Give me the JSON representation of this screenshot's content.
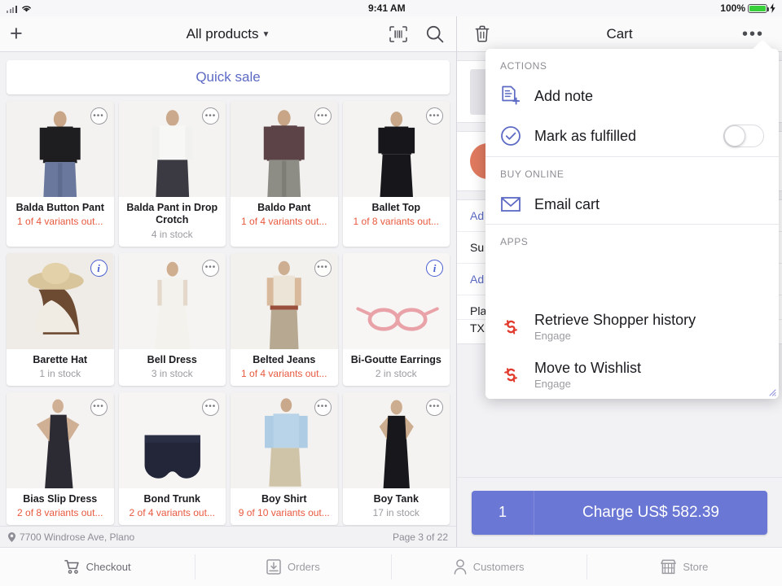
{
  "status_bar": {
    "time": "9:41 AM",
    "battery_percent": "100%",
    "signal_icon": "cellular-bars-icon",
    "wifi_icon": "wifi-icon",
    "battery_icon": "battery-icon",
    "charging_icon": "lightning-bolt-icon"
  },
  "left_pane": {
    "nav": {
      "add_icon": "plus-icon",
      "title": "All products",
      "caret_icon": "chevron-down-icon",
      "scan_icon": "barcode-scan-icon",
      "search_icon": "search-icon"
    },
    "quick_sale_label": "Quick sale",
    "products": [
      {
        "name": "Balda Button Pant",
        "stock": "1 of 4 variants out...",
        "warn": true,
        "badge": "more-options-icon"
      },
      {
        "name": "Balda Pant in Drop Crotch",
        "stock": "4 in stock",
        "warn": false,
        "badge": "more-options-icon"
      },
      {
        "name": "Baldo Pant",
        "stock": "1 of 4 variants out...",
        "warn": true,
        "badge": "more-options-icon"
      },
      {
        "name": "Ballet Top",
        "stock": "1 of 8 variants out...",
        "warn": true,
        "badge": "more-options-icon"
      },
      {
        "name": "Barette Hat",
        "stock": "1 in stock",
        "warn": false,
        "badge": "info-icon"
      },
      {
        "name": "Bell Dress",
        "stock": "3 in stock",
        "warn": false,
        "badge": "more-options-icon"
      },
      {
        "name": "Belted Jeans",
        "stock": "1 of 4 variants out...",
        "warn": true,
        "badge": "more-options-icon"
      },
      {
        "name": "Bi-Goutte Earrings",
        "stock": "2 in stock",
        "warn": false,
        "badge": "info-icon"
      },
      {
        "name": "Bias Slip Dress",
        "stock": "2 of 8 variants out...",
        "warn": true,
        "badge": "more-options-icon"
      },
      {
        "name": "Bond Trunk",
        "stock": "2 of 4 variants out...",
        "warn": true,
        "badge": "more-options-icon"
      },
      {
        "name": "Boy Shirt",
        "stock": "9 of 10 variants out...",
        "warn": true,
        "badge": "more-options-icon"
      },
      {
        "name": "Boy Tank",
        "stock": "17 in stock",
        "warn": false,
        "badge": "more-options-icon"
      }
    ],
    "footer": {
      "location_icon": "map-pin-icon",
      "location": "7700 Windrose Ave, Plano",
      "page": "Page 3 of 22"
    }
  },
  "right_pane": {
    "nav": {
      "trash_icon": "trash-icon",
      "title": "Cart",
      "overflow_icon": "more-options-icon"
    },
    "cart_rows": [
      {
        "text": "Ad"
      },
      {
        "text": "Su"
      },
      {
        "text": "Ad"
      },
      {
        "text": "Pla"
      },
      {
        "text": "TX"
      }
    ],
    "charge": {
      "quantity": "1",
      "label": "Charge US$ 582.39"
    }
  },
  "popover": {
    "sections": [
      {
        "header": "ACTIONS",
        "items": [
          {
            "label": "Add note",
            "icon": "note-add-icon",
            "sub": "",
            "toggle": false
          },
          {
            "label": "Mark as fulfilled",
            "icon": "check-circle-icon",
            "sub": "",
            "toggle": true,
            "toggle_state": "off"
          }
        ]
      },
      {
        "header": "BUY ONLINE",
        "items": [
          {
            "label": "Email cart",
            "icon": "envelope-icon",
            "sub": "",
            "toggle": false
          }
        ]
      },
      {
        "header": "APPS",
        "items": [
          {
            "label": "Retrieve Shopper history",
            "icon": "refresh-swirl-icon",
            "sub": "Engage",
            "toggle": false
          },
          {
            "label": "Move to Wishlist",
            "icon": "refresh-swirl-icon",
            "sub": "Engage",
            "toggle": false
          }
        ]
      }
    ],
    "resize_handle_icon": "resize-grip-icon"
  },
  "tab_bar": {
    "tabs": [
      {
        "label": "Checkout",
        "icon": "shopping-cart-icon",
        "active": true
      },
      {
        "label": "Orders",
        "icon": "orders-inbox-icon",
        "active": false
      },
      {
        "label": "Customers",
        "icon": "person-icon",
        "active": false
      },
      {
        "label": "Store",
        "icon": "storefront-icon",
        "active": false
      }
    ]
  },
  "colors": {
    "accent": "#5c6ac4",
    "charge_button": "#6a77d4",
    "warning_text": "#e8593f",
    "battery_green": "#37d03b",
    "avatar": "#e07a5f",
    "app_icon_red": "#e23b2e"
  }
}
